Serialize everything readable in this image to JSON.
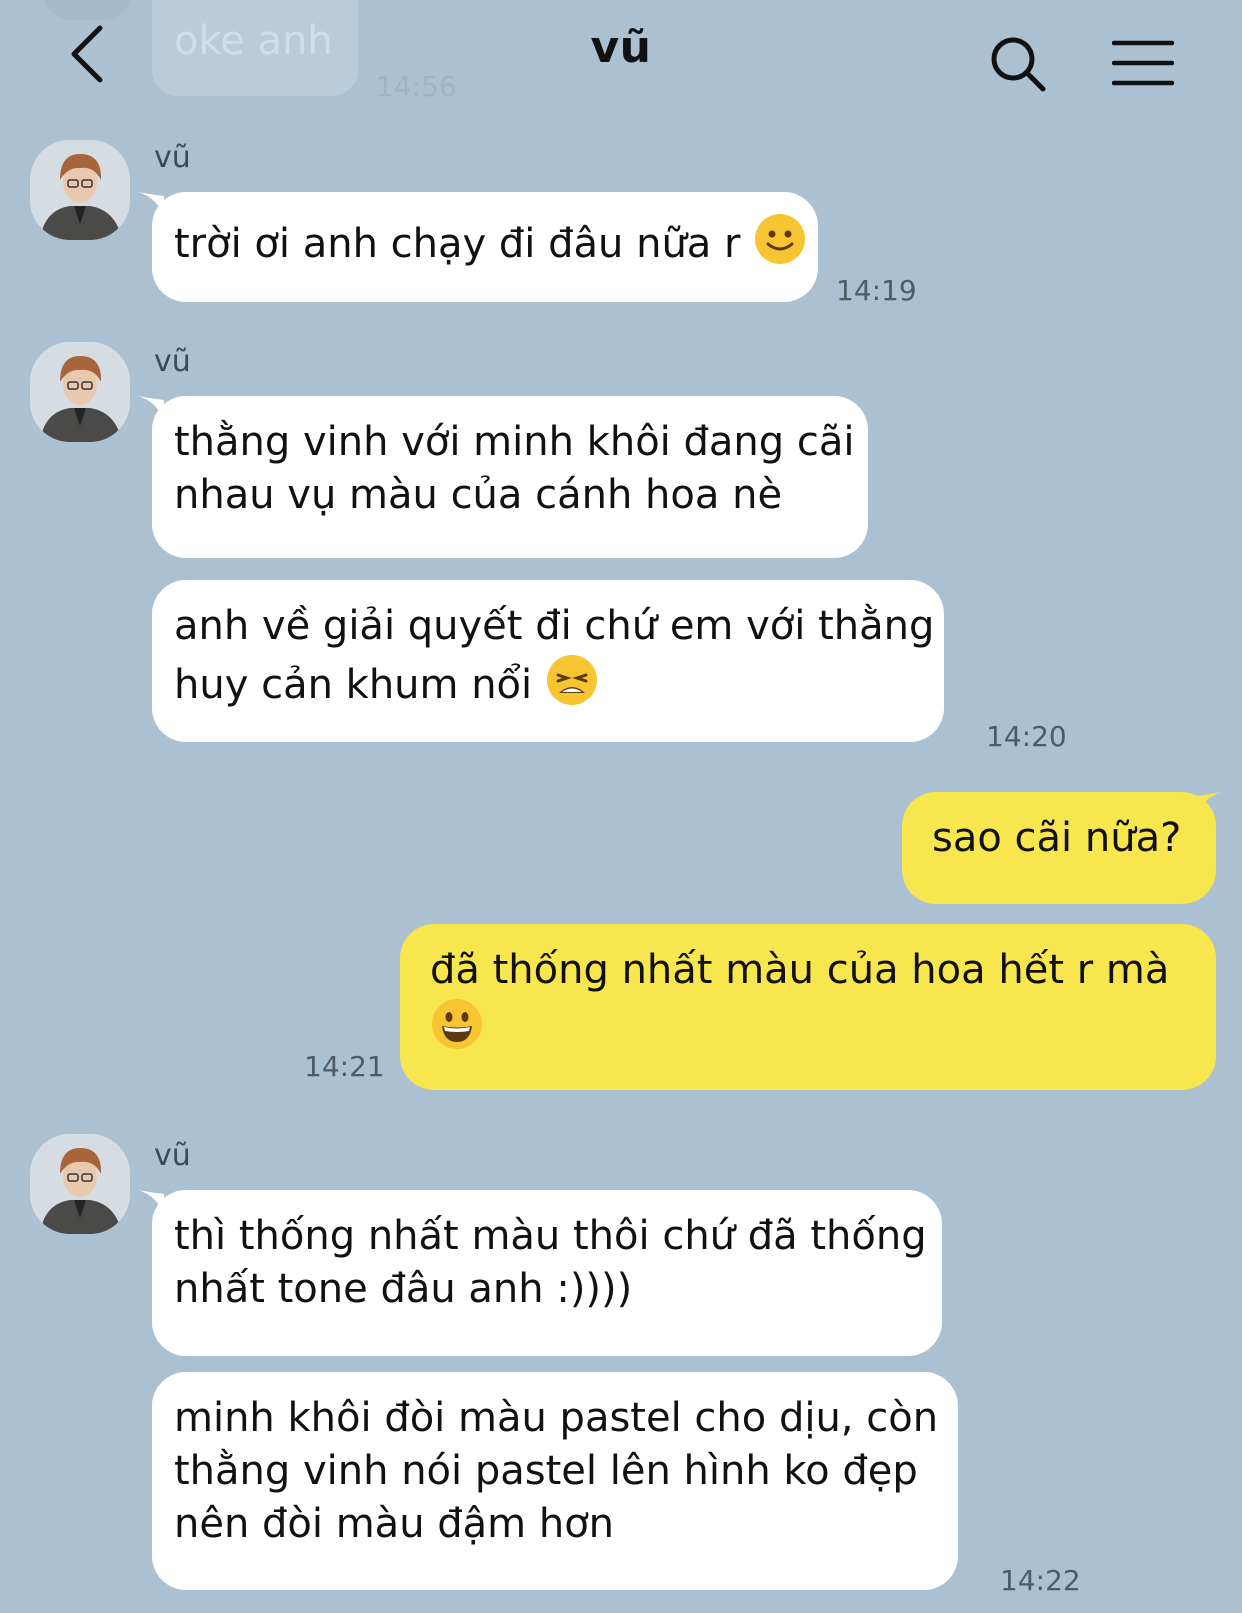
{
  "header": {
    "title": "vũ",
    "back_icon": "chevron-left-icon",
    "search_icon": "search-icon",
    "menu_icon": "hamburger-menu-icon"
  },
  "previous_message": {
    "text": "oke anh",
    "time": "14:56"
  },
  "messages": [
    {
      "sender": "vũ",
      "lines": [
        "trời ơi anh chạy đi đâu nữa r"
      ],
      "emoji": "slightly-smiling-face",
      "time": "14:19"
    },
    {
      "sender": "vũ",
      "lines": [
        "thằng vinh với minh khôi đang cãi",
        "nhau vụ màu của cánh hoa nè"
      ]
    },
    {
      "lines": [
        "anh về giải quyết đi chứ em với thằng",
        "huy cản khum nổi"
      ],
      "emoji": "weary-face",
      "time": "14:20"
    },
    {
      "mine": true,
      "lines": [
        "sao cãi nữa?"
      ]
    },
    {
      "mine": true,
      "lines": [
        "đã thống nhất màu của hoa hết r mà"
      ],
      "emoji": "grinning-face",
      "time": "14:21"
    },
    {
      "sender": "vũ",
      "lines": [
        "thì thống nhất màu thôi chứ đã thống",
        "nhất tone đâu anh :))))"
      ]
    },
    {
      "lines": [
        "minh khôi đòi màu pastel cho dịu, còn",
        "thằng vinh nói pastel lên hình ko đẹp",
        "nên đòi màu đậm hơn"
      ],
      "time": "14:22"
    }
  ],
  "colors": {
    "background": "#abc1d1",
    "incoming_bubble": "#ffffff",
    "outgoing_bubble": "#f8e64f"
  }
}
